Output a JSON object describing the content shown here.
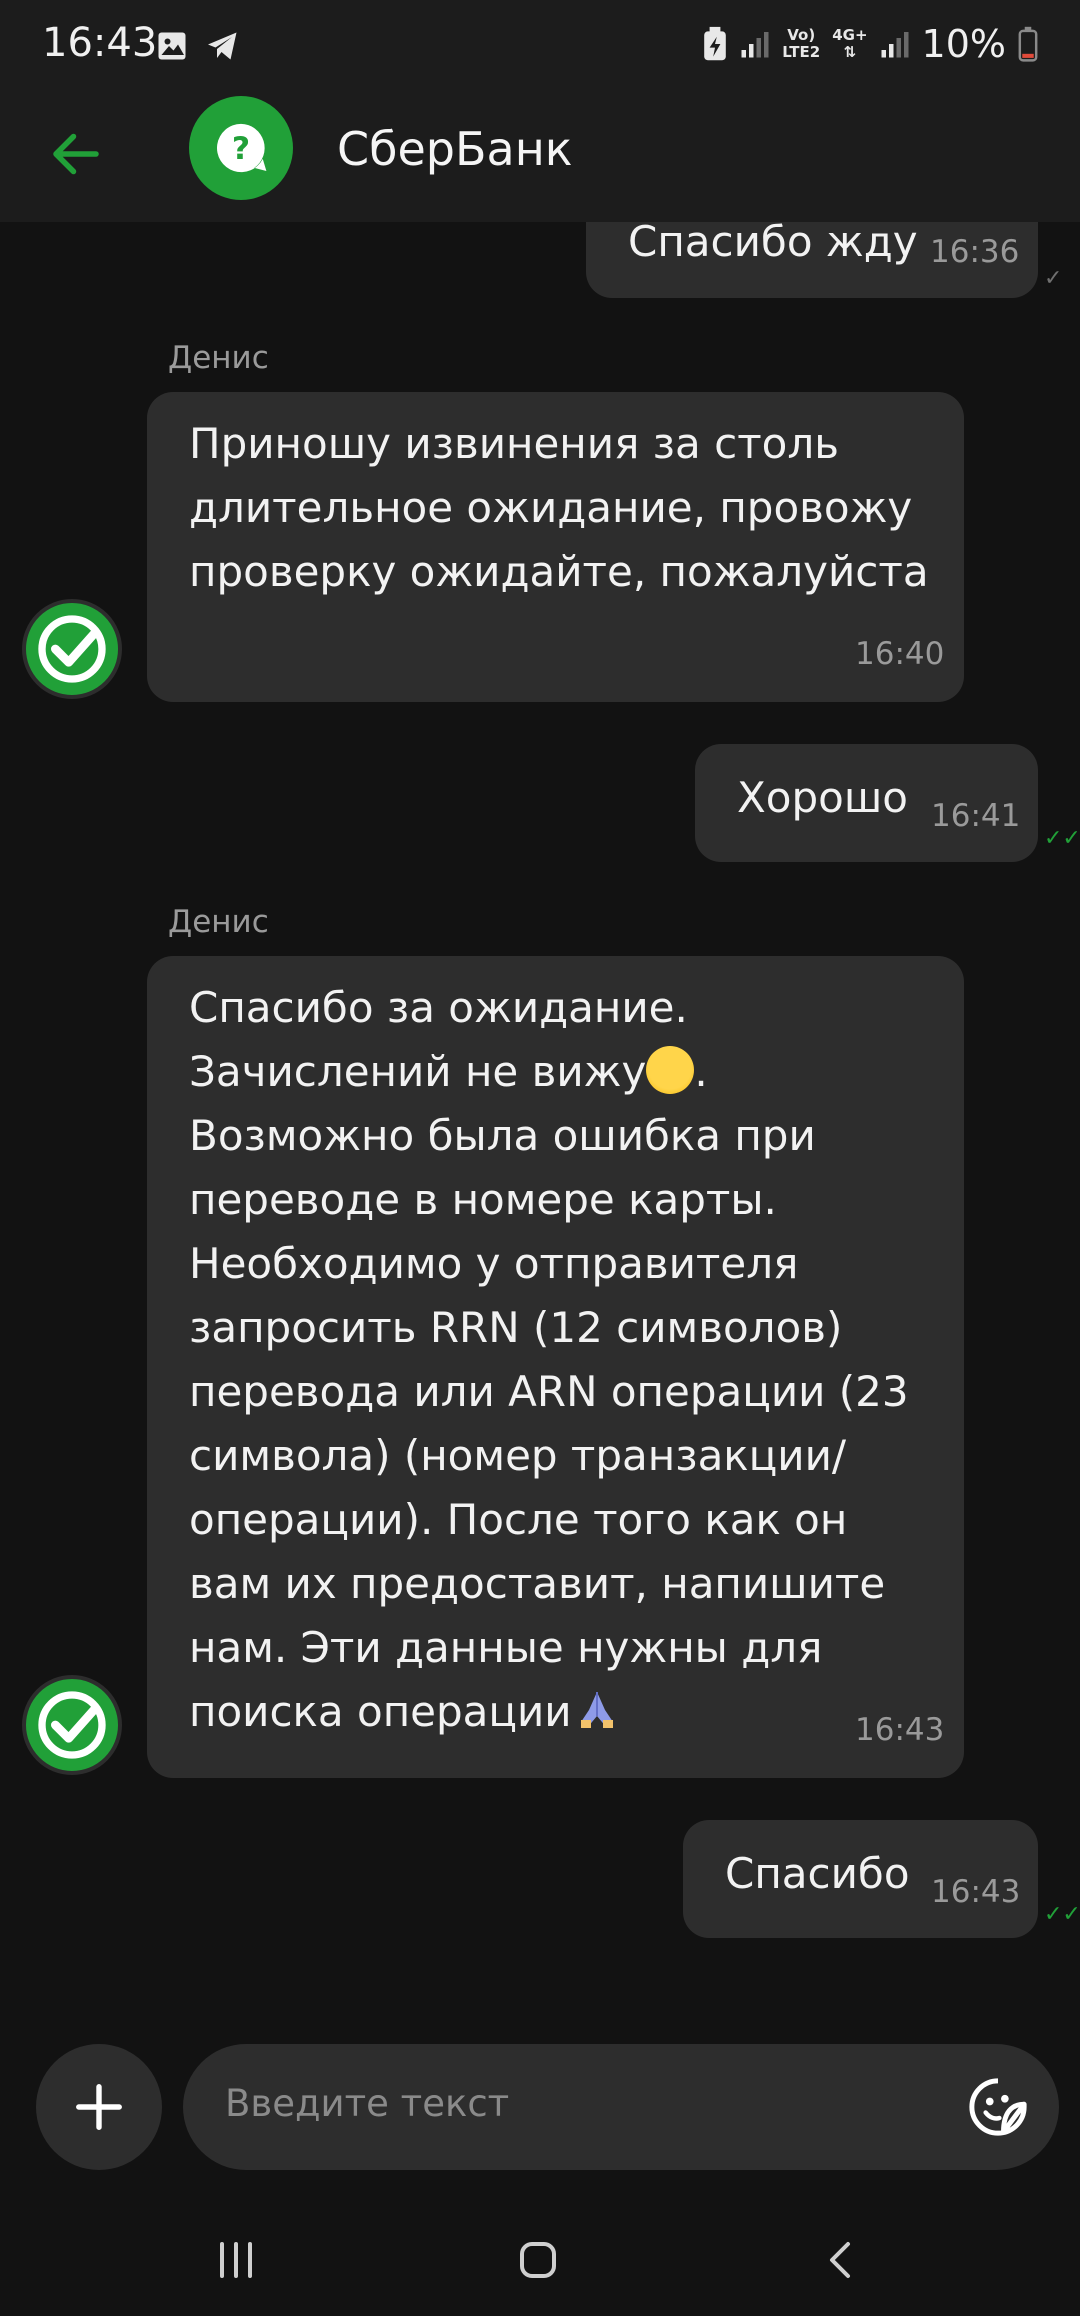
{
  "status_bar": {
    "time": "16:43",
    "battery_percent": "10%",
    "network_label_1": "Vo)",
    "network_label_2": "LTE2",
    "network_label_3": "4G+",
    "icons": [
      "gallery-icon",
      "telegram-icon",
      "battery-saver-icon",
      "signal-icon",
      "signal-icon",
      "battery-icon"
    ]
  },
  "header": {
    "title": "СберБанк",
    "back_icon": "back-arrow-icon",
    "logo_icon": "question-chat-icon"
  },
  "messages": [
    {
      "direction": "out",
      "text": "Спасибо жду",
      "time": "16:36",
      "status": "sent"
    },
    {
      "direction": "in",
      "sender": "Денис",
      "lines": [
        "Приношу извинения за столь",
        "длительное ожидание, провожу",
        "проверку ожидайте, пожалуйста"
      ],
      "time": "16:40"
    },
    {
      "direction": "out",
      "text": "Хорошо",
      "time": "16:41",
      "status": "read"
    },
    {
      "direction": "in",
      "sender": "Денис",
      "lines": [
        "Спасибо за ожидание.",
        "Зачислений не вижу",
        "Возможно была ошибка при",
        "переводе в номере карты.",
        "Необходимо у отправителя",
        "запросить RRN (12 символов)",
        "перевода или ARN операции (23",
        "символа) (номер транзакции/",
        "операции). После того как он",
        "вам их предоставит, напишите",
        "нам. Эти данные нужны для",
        "поиска операции"
      ],
      "line2_suffix": ".",
      "time": "16:43"
    },
    {
      "direction": "out",
      "text": "Спасибо",
      "time": "16:43",
      "status": "read"
    }
  ],
  "composer": {
    "placeholder": "Введите текст",
    "plus_icon": "plus-icon",
    "sticker_icon": "sticker-icon"
  },
  "colors": {
    "accent": "#21a038",
    "background": "#121212",
    "bubble": "#2d2d2d",
    "header": "#1c1c1c"
  }
}
